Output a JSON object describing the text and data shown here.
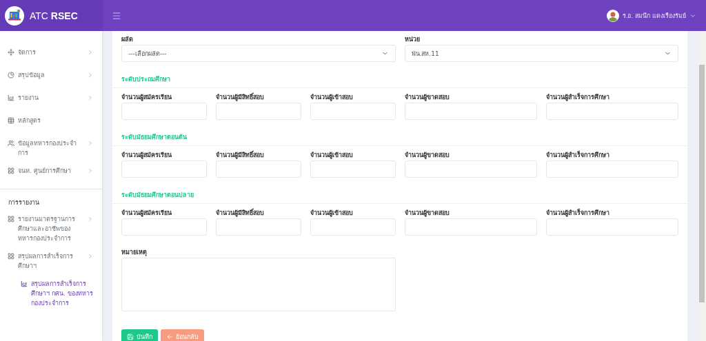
{
  "header": {
    "brand_light": "ATC",
    "brand_bold": "RSEC",
    "user_name": "ร.อ. สมนึก แดงเรืองรัมย์"
  },
  "sidebar": {
    "items": [
      {
        "label": "จัดการ",
        "kind": "move",
        "expandable": true
      },
      {
        "label": "สรุปข้อมูล",
        "kind": "pie",
        "expandable": true
      },
      {
        "label": "รายงาน",
        "kind": "chart",
        "expandable": true
      },
      {
        "label": "หลักสูตร",
        "kind": "table",
        "expandable": false
      },
      {
        "label": "ข้อมูลทหารกองประจำการ",
        "kind": "users",
        "expandable": true
      },
      {
        "label": "จนท. ศูนย์การศึกษา",
        "kind": "grid",
        "expandable": true
      }
    ],
    "section_title": "การรายงาน",
    "report_items": [
      {
        "label": "รายงานมาตรฐานการศึกษาและอาชีพของทหารกองประจำการ",
        "kind": "grid",
        "expandable": true
      },
      {
        "label": "สรุปผลการสำเร็จการศึกษาฯ",
        "kind": "grid",
        "expandable": true,
        "children": [
          {
            "label": "สรุปผลการสำเร็จการศึกษาฯ กศน. ของทหารกองประจำการ",
            "kind": "chart",
            "selected": true
          }
        ]
      }
    ]
  },
  "form": {
    "selects": [
      {
        "label": "ผลัด",
        "value": "---เลือกผลัด---"
      },
      {
        "label": "หน่วย",
        "value": "พัน.สห.11"
      }
    ],
    "sections": [
      {
        "title": "ระดับประถมศึกษา",
        "columns": [
          "จำนวนผู้สมัครเรียน",
          "จำนวนผู้มีสิทธิ์สอบ",
          "จำนวนผู้เข้าสอบ",
          "จำนวนผู้ขาดสอบ",
          "จำนวนผู้สำเร็จการศึกษา"
        ]
      },
      {
        "title": "ระดับมัธยมศึกษาตอนต้น",
        "columns": [
          "จำนวนผู้สมัครเรียน",
          "จำนวนผู้มีสิทธิ์สอบ",
          "จำนวนผู้เข้าสอบ",
          "จำนวนผู้ขาดสอบ",
          "จำนวนผู้สำเร็จการศึกษา"
        ]
      },
      {
        "title": "ระดับมัธยมศึกษาตอนปลาย",
        "columns": [
          "จำนวนผู้สมัครเรียน",
          "จำนวนผู้มีสิทธิ์สอบ",
          "จำนวนผู้เข้าสอบ",
          "จำนวนผู้ขาดสอบ",
          "จำนวนผู้สำเร็จการศึกษา"
        ]
      }
    ],
    "remark_label": "หมายเหตุ",
    "buttons": [
      {
        "label": "บันทึก",
        "kind": "save"
      },
      {
        "label": "ย้อนกลับ",
        "kind": "back"
      }
    ]
  }
}
